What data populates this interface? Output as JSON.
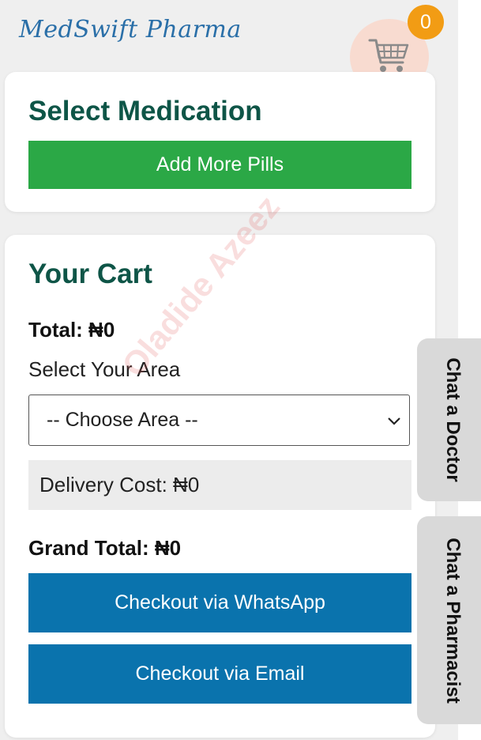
{
  "header": {
    "brand": "MedSwift Pharma",
    "cart_count": "0"
  },
  "select_medication": {
    "title": "Select Medication",
    "add_button": "Add More Pills"
  },
  "cart": {
    "title": "Your Cart",
    "total": "Total: ₦0",
    "area_label": "Select Your Area",
    "area_select_value": "-- Choose Area --",
    "delivery_cost": "Delivery Cost: ₦0",
    "grand_total": "Grand Total: ₦0",
    "checkout_whatsapp": "Checkout via WhatsApp",
    "checkout_email": "Checkout via Email"
  },
  "side_tabs": {
    "doctor": "Chat a Doctor",
    "pharmacist": "Chat a Pharmacist"
  },
  "watermark": "Oladide Azeez",
  "colors": {
    "brand": "#2a6fa8",
    "heading": "#0e5547",
    "green_button": "#2ba846",
    "blue_button": "#0a73ad",
    "badge": "#f29c14",
    "cart_circle": "#f8dbd0"
  },
  "icons": {
    "cart": "shopping-cart-icon",
    "select_chevron": "chevron-down-icon"
  }
}
